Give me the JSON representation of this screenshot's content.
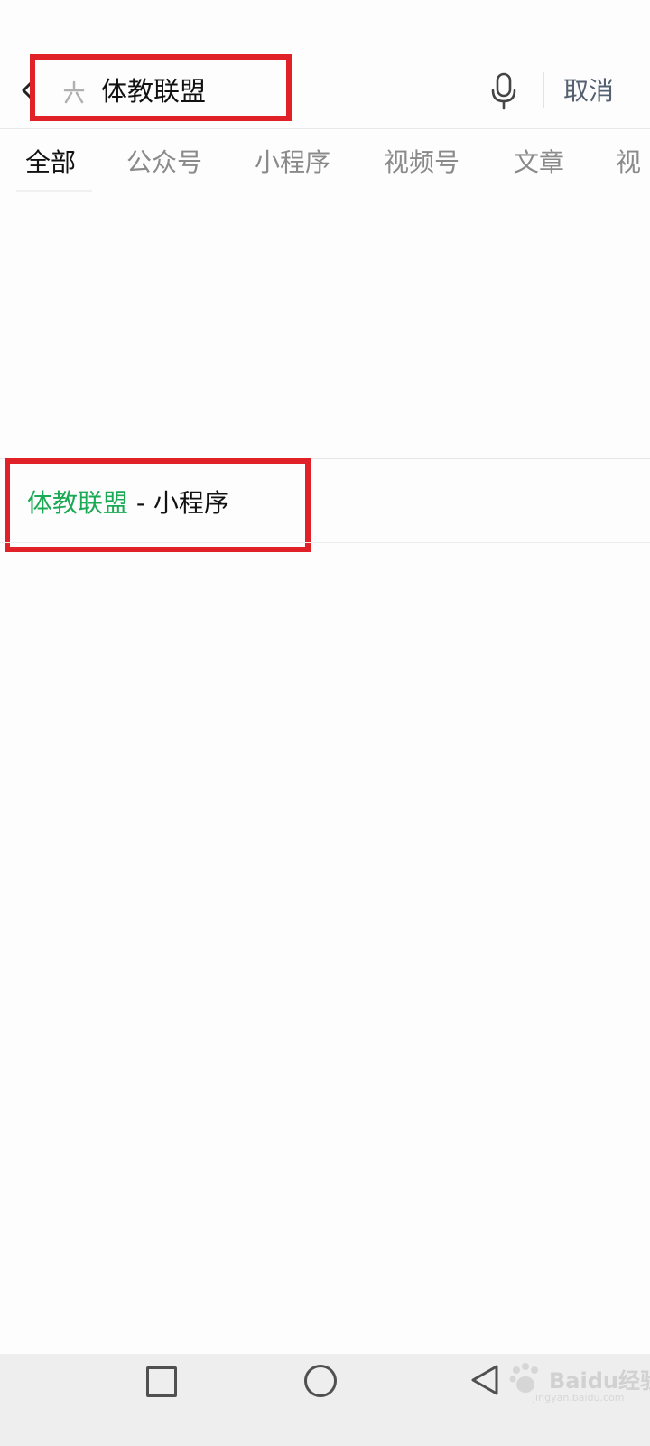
{
  "search": {
    "value": "体教联盟",
    "cancel_label": "取消"
  },
  "tabs": [
    {
      "label": "全部",
      "active": true
    },
    {
      "label": "公众号",
      "active": false
    },
    {
      "label": "小程序",
      "active": false
    },
    {
      "label": "视频号",
      "active": false
    },
    {
      "label": "文章",
      "active": false
    },
    {
      "label": "视",
      "active": false
    }
  ],
  "result": {
    "name": "体教联盟",
    "suffix": " - 小程序"
  },
  "icons": {
    "back": "chevron-left-icon",
    "search_prefix": "sparkle-icon",
    "mic": "microphone-icon",
    "nav_recent": "square-icon",
    "nav_home": "circle-icon",
    "nav_back": "triangle-back-icon"
  },
  "watermark": {
    "brand": "Baidu经验",
    "sub": "jingyan.baidu.com"
  },
  "colors": {
    "highlight_border": "#e02128",
    "result_name": "#1aaa55"
  }
}
